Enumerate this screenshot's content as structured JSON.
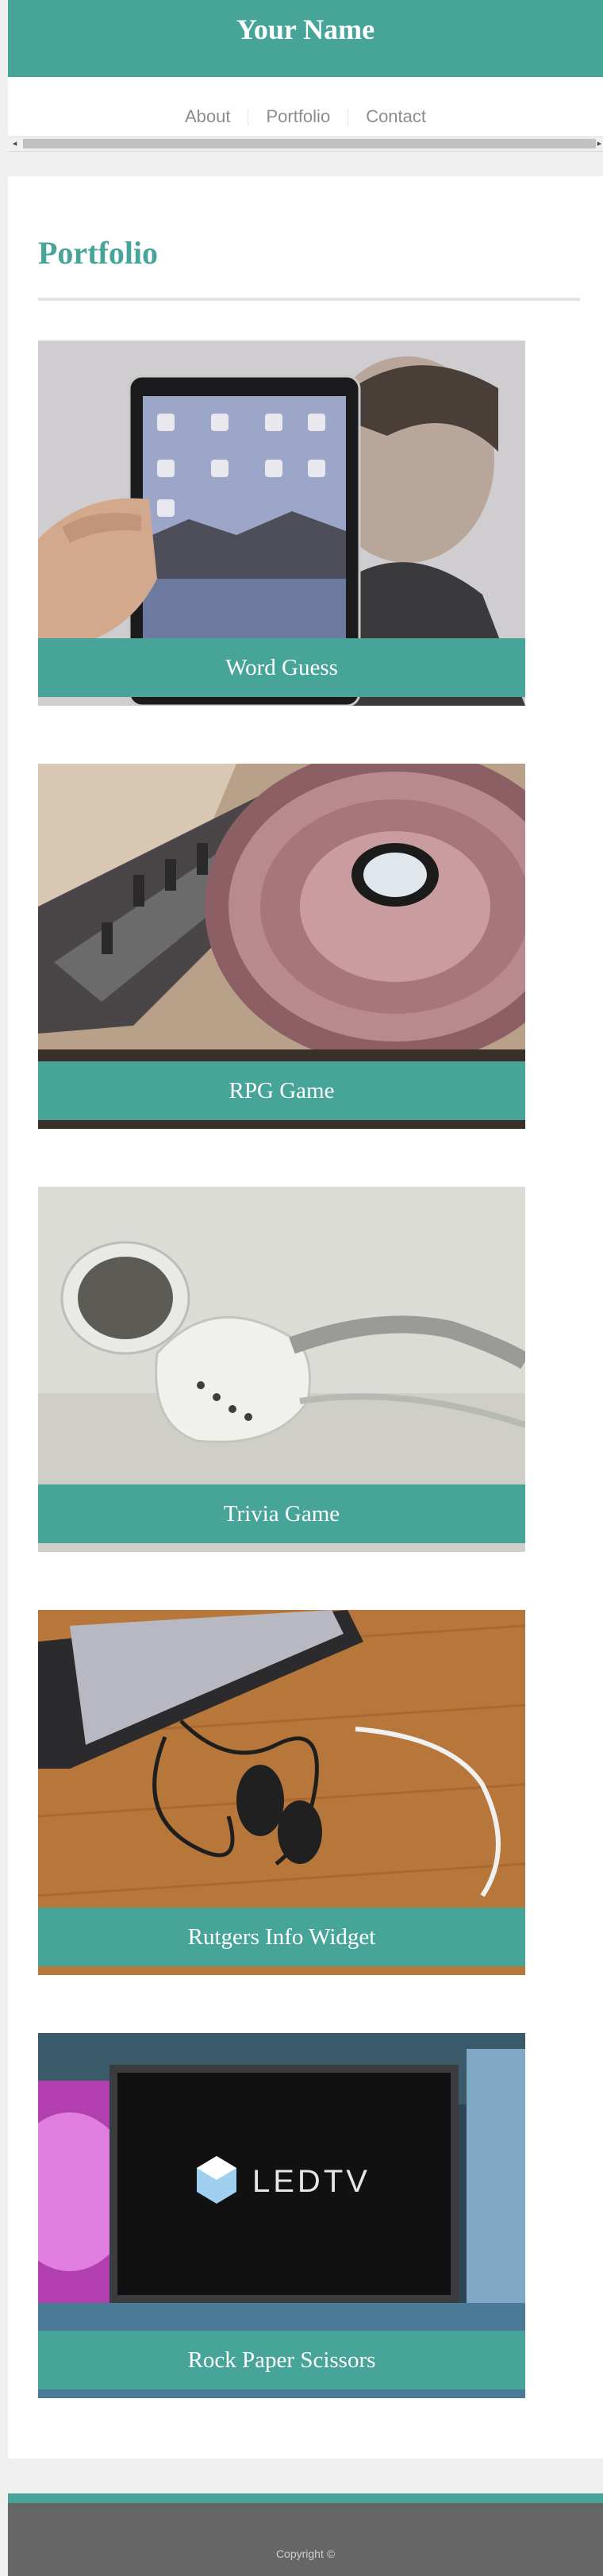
{
  "header": {
    "title": "Your Name"
  },
  "nav": {
    "items": [
      "About",
      "Portfolio",
      "Contact"
    ]
  },
  "main": {
    "title": "Portfolio",
    "projects": [
      {
        "label": "Word Guess",
        "image": "tablet-held-by-man-photo"
      },
      {
        "label": "RPG Game",
        "image": "turntable-mixer-photo"
      },
      {
        "label": "Trivia Game",
        "image": "earbud-headphones-photo"
      },
      {
        "label": "Rutgers Info Widget",
        "image": "smartphone-with-earphones-photo"
      },
      {
        "label": "Rock Paper Scissors",
        "image": "led-tv-display-photo"
      }
    ]
  },
  "footer": {
    "copyright": "Copyright ©"
  },
  "colors": {
    "accent": "#46a598",
    "footer": "#666666",
    "page_bg": "#efefef"
  }
}
